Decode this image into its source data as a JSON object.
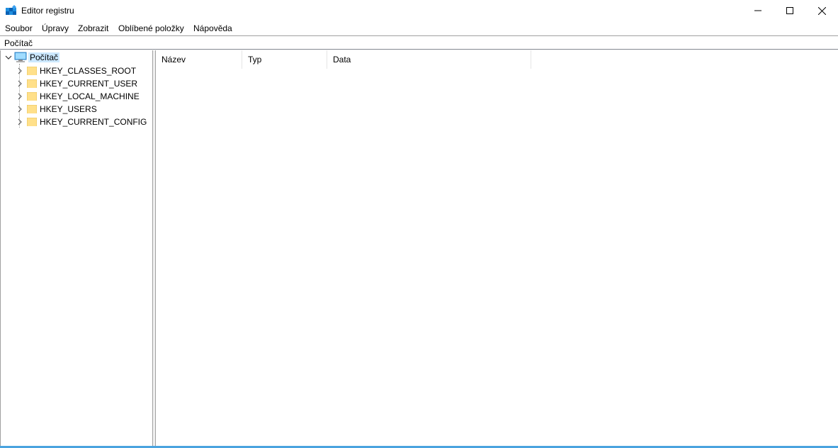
{
  "window": {
    "title": "Editor registru",
    "controls": {
      "minimize": "minimize-icon",
      "maximize": "maximize-icon",
      "close": "close-icon"
    }
  },
  "menu": {
    "items": [
      "Soubor",
      "Úpravy",
      "Zobrazit",
      "Oblíbené položky",
      "Nápověda"
    ]
  },
  "address": {
    "path": "Počítač"
  },
  "tree": {
    "root": {
      "label": "Počítač",
      "expanded": true,
      "icon": "computer-icon"
    },
    "children": [
      {
        "label": "HKEY_CLASSES_ROOT",
        "icon": "folder-icon"
      },
      {
        "label": "HKEY_CURRENT_USER",
        "icon": "folder-icon"
      },
      {
        "label": "HKEY_LOCAL_MACHINE",
        "icon": "folder-icon"
      },
      {
        "label": "HKEY_USERS",
        "icon": "folder-icon"
      },
      {
        "label": "HKEY_CURRENT_CONFIG",
        "icon": "folder-icon"
      }
    ]
  },
  "list": {
    "columns": [
      "Název",
      "Typ",
      "Data"
    ],
    "rows": []
  },
  "colors": {
    "selection": "#cce8ff",
    "folder": "#ffd86b",
    "accent": "#0078d7"
  }
}
